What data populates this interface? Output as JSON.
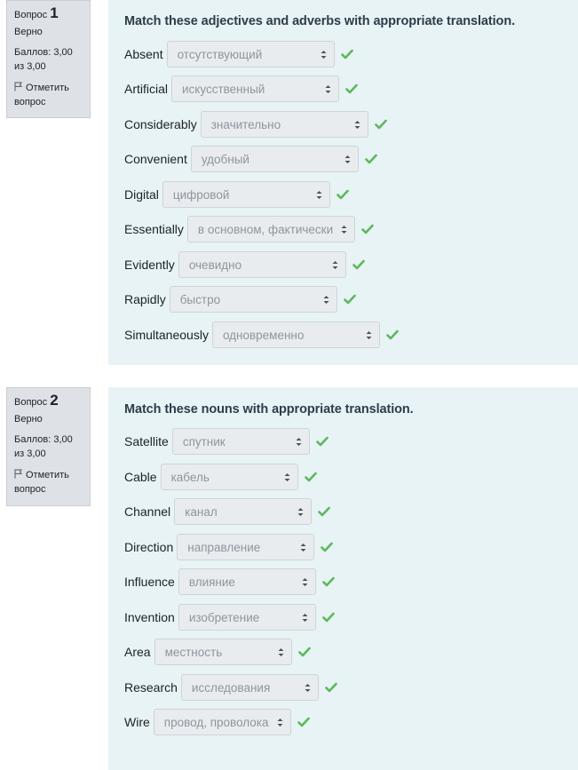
{
  "questions": [
    {
      "label": "Вопрос",
      "number": "1",
      "state": "Верно",
      "grade": "Баллов: 3,00 из 3,00",
      "flag_label": "Отметить вопрос",
      "prompt": "Match these adjectives and adverbs with appropriate translation.",
      "rows": [
        {
          "term": "Absent",
          "answer": "отсутствующий"
        },
        {
          "term": "Artificial",
          "answer": "искусственный"
        },
        {
          "term": "Considerably",
          "answer": "значительно"
        },
        {
          "term": "Convenient",
          "answer": "удобный"
        },
        {
          "term": "Digital",
          "answer": "цифровой"
        },
        {
          "term": "Essentially",
          "answer": "в основном, фактически"
        },
        {
          "term": "Evidently",
          "answer": "очевидно"
        },
        {
          "term": "Rapidly",
          "answer": "быстро"
        },
        {
          "term": "Simultaneously",
          "answer": "одновременно"
        }
      ]
    },
    {
      "label": "Вопрос",
      "number": "2",
      "state": "Верно",
      "grade": "Баллов: 3,00 из 3,00",
      "flag_label": "Отметить вопрос",
      "prompt": "Match these nouns with appropriate translation.",
      "rows": [
        {
          "term": "Satellite",
          "answer": "спутник"
        },
        {
          "term": "Cable",
          "answer": "кабель"
        },
        {
          "term": "Channel",
          "answer": "канал"
        },
        {
          "term": "Direction",
          "answer": "направление"
        },
        {
          "term": "Influence",
          "answer": "влияние"
        },
        {
          "term": "Invention",
          "answer": "изобретение"
        },
        {
          "term": "Area",
          "answer": "местность"
        },
        {
          "term": "Research",
          "answer": "исследования"
        },
        {
          "term": "Wire",
          "answer": "провод, проволока"
        }
      ]
    }
  ],
  "icons": {
    "correct": "check-icon",
    "flag": "flag-icon",
    "select": "sort-caret-icon"
  },
  "colors": {
    "correct": "#5cb85c",
    "content_bg": "#e7f3f5",
    "info_bg": "#dee2e6"
  }
}
